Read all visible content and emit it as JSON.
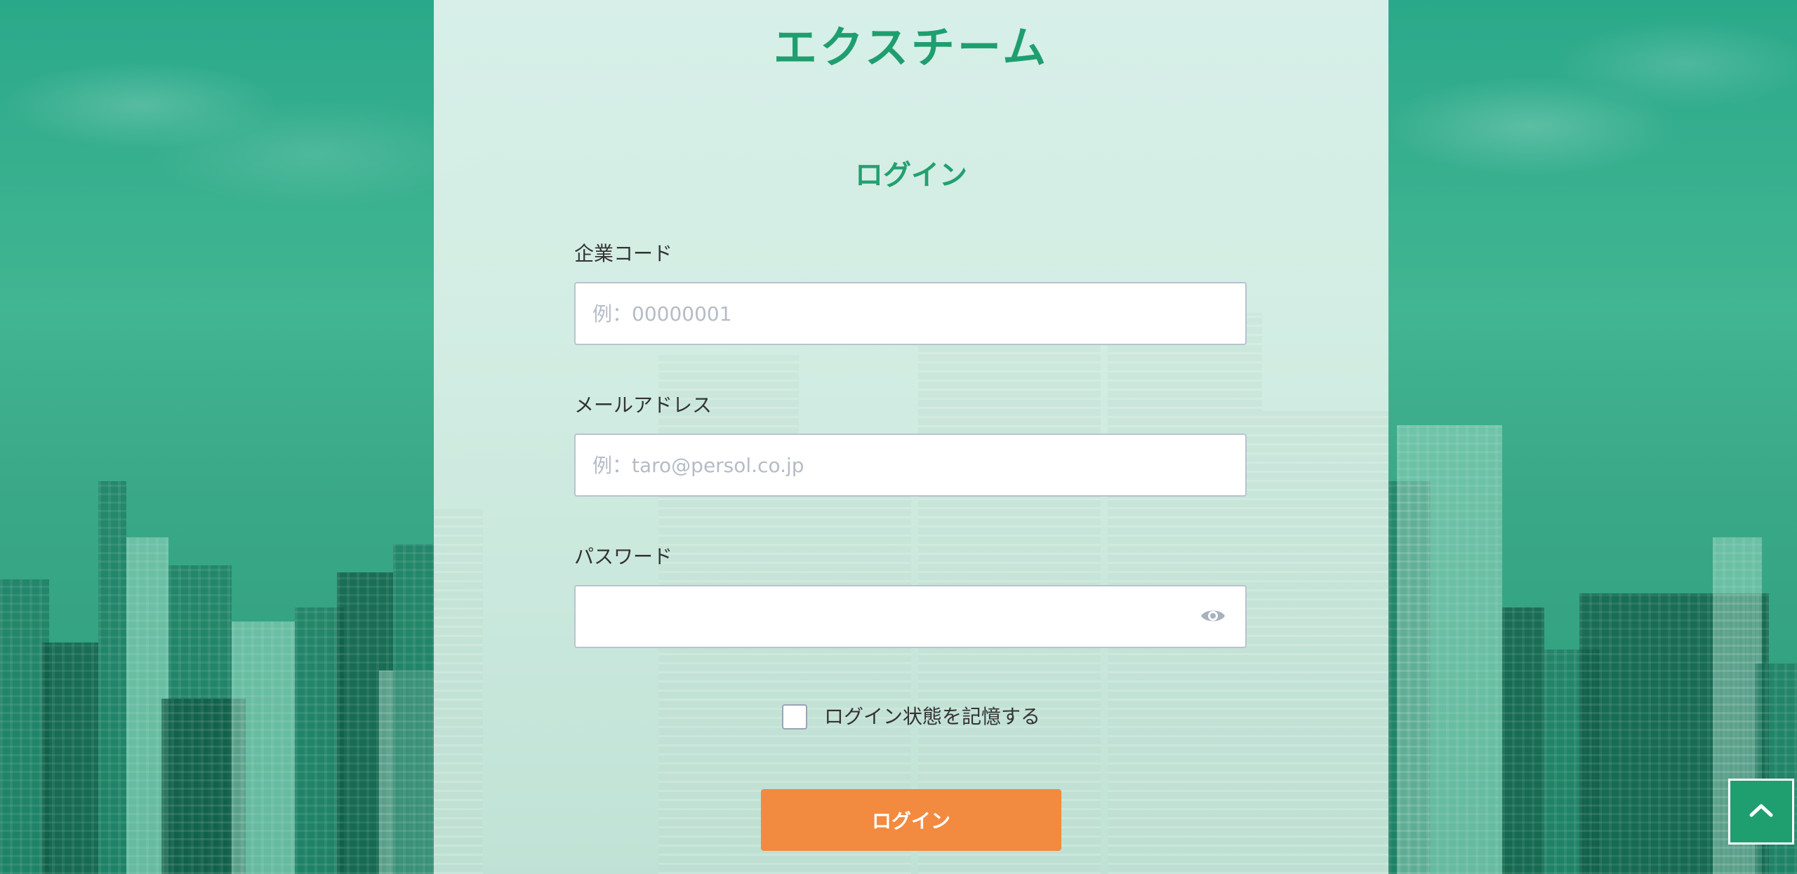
{
  "brand": {
    "logo_text": "エクスチーム"
  },
  "login_form": {
    "title": "ログイン",
    "company_code": {
      "label": "企業コード",
      "value": "",
      "placeholder": "例：00000001"
    },
    "email": {
      "label": "メールアドレス",
      "value": "",
      "placeholder": "例：taro@persol.co.jp"
    },
    "password": {
      "label": "パスワード",
      "value": "",
      "toggle_icon": "eye-icon"
    },
    "remember": {
      "label": "ログイン状態を記憶する",
      "checked": false
    },
    "submit_label": "ログイン"
  },
  "scroll_top": {
    "icon": "chevron-up-icon"
  },
  "colors": {
    "brand_green": "#1f9e6f",
    "button_orange": "#f28a3f",
    "input_border": "#b9c2d0",
    "text": "#333333"
  }
}
